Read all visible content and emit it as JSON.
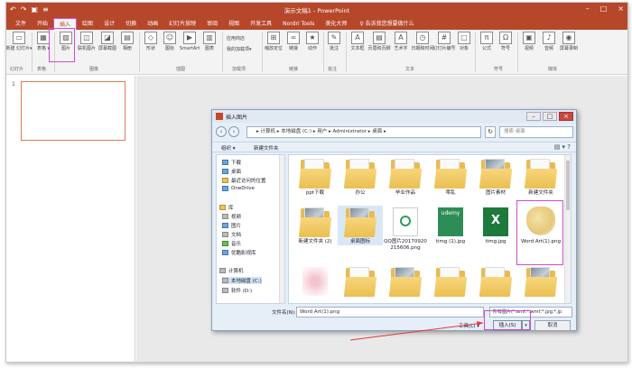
{
  "app": {
    "title": "演示文稿1 - PowerPoint",
    "qat": [
      "↶",
      "↷",
      "▣",
      "≡"
    ]
  },
  "ribbon_tabs": [
    "文件",
    "开始",
    "插入",
    "绘图",
    "设计",
    "切换",
    "动画",
    "幻灯片放映",
    "审阅",
    "视图",
    "开发工具",
    "Nordri Tools",
    "美化大师"
  ],
  "active_tab_index": 2,
  "tell_me": "♀ 告诉我您想要做什么",
  "ribbon": {
    "slides": {
      "label": "新建\n幻灯片▾",
      "group": "幻灯片"
    },
    "table": {
      "label": "表格\n▾",
      "group": "表格"
    },
    "images": {
      "buttons": [
        "图片",
        "联机图片",
        "屏幕截图",
        "相册"
      ],
      "group": "图像"
    },
    "illustrations": {
      "buttons": [
        "形状",
        "图标",
        "SmartArt",
        "图表"
      ],
      "group": "插图"
    },
    "addins": {
      "items": [
        "应用商店",
        "我的加载项▾"
      ],
      "group": "加载项"
    },
    "links": {
      "buttons": [
        "缩放定位",
        "链接",
        "动作"
      ],
      "group": "链接"
    },
    "comments": {
      "buttons": [
        "批注"
      ],
      "group": "批注"
    },
    "text": {
      "buttons": [
        "文本框",
        "页眉和页脚",
        "艺术字",
        "日期和时间",
        "幻灯片编号",
        "对象"
      ],
      "group": "文本"
    },
    "symbols": {
      "buttons": [
        "公式",
        "符号"
      ],
      "group": "符号"
    },
    "media": {
      "buttons": [
        "视频",
        "音频",
        "屏幕录制"
      ],
      "group": "媒体"
    }
  },
  "slide_pane": {
    "slide_number": "1"
  },
  "dialog": {
    "title": "插入图片",
    "address": "▸ 计算机 ▸ 本地磁盘 (C:) ▸ 用户 ▸ Administrator ▸ 桌面 ▸",
    "search_placeholder": "搜索 桌面",
    "toolbar": {
      "organize": "组织 ▾",
      "new_folder": "新建文件夹"
    },
    "nav_items": [
      {
        "label": "下载",
        "icon": "download-icon",
        "kind": "blue"
      },
      {
        "label": "桌面",
        "icon": "desktop-icon",
        "kind": "blue"
      },
      {
        "label": "最近访问的位置",
        "icon": "recent-icon",
        "kind": "yellow"
      },
      {
        "label": "OneDrive",
        "icon": "cloud-icon",
        "kind": "blue"
      },
      {
        "label": "库",
        "icon": "library-icon",
        "kind": "yellow"
      },
      {
        "label": "视频",
        "icon": "video-icon",
        "kind": "gray"
      },
      {
        "label": "图片",
        "icon": "picture-icon",
        "kind": "blue"
      },
      {
        "label": "文档",
        "icon": "document-icon",
        "kind": "gray"
      },
      {
        "label": "音乐",
        "icon": "music-icon",
        "kind": "green"
      },
      {
        "label": "优酷影视库",
        "icon": "video-library-icon",
        "kind": "blue"
      },
      {
        "label": "计算机",
        "icon": "computer-icon",
        "kind": "gray"
      },
      {
        "label": "本地磁盘 (C:)",
        "icon": "drive-icon",
        "kind": "gray"
      },
      {
        "label": "软件 (D:)",
        "icon": "drive-icon",
        "kind": "gray"
      }
    ],
    "files": [
      {
        "label": "ppt下载",
        "kind": "folder"
      },
      {
        "label": "办公",
        "kind": "folder"
      },
      {
        "label": "毕业作品",
        "kind": "folder"
      },
      {
        "label": "零乱",
        "kind": "folder"
      },
      {
        "label": "图片素材",
        "kind": "folder-pic"
      },
      {
        "label": "新建文件夹",
        "kind": "folder"
      },
      {
        "label": "新建文件夹 (2)",
        "kind": "folder-pic"
      },
      {
        "label": "桌面图标",
        "kind": "folder-pic"
      },
      {
        "label": "QQ图片20170920215606.png",
        "kind": "qq"
      },
      {
        "label": "timg (1).jpg",
        "kind": "udemy"
      },
      {
        "label": "timg.jpg",
        "kind": "xls"
      },
      {
        "label": "Word Art(1).png",
        "kind": "heart"
      },
      {
        "label": "",
        "kind": "pinkart"
      },
      {
        "label": "",
        "kind": "folder"
      },
      {
        "label": "",
        "kind": "folder-pic"
      },
      {
        "label": "",
        "kind": "folder"
      },
      {
        "label": "",
        "kind": "folder"
      },
      {
        "label": "",
        "kind": "folder-pic"
      }
    ],
    "filename_label": "文件名(N):",
    "filename_value": "Word Art(1).png",
    "filetype_value": "所有图片(*.emf;*.wmf;*.jpg;*.jp",
    "tools_label": "工具(L) ▾",
    "insert_label": "插入(S)",
    "insert_dropdown": "▾",
    "cancel_label": "取消",
    "udemy_text": "udemy",
    "xls_text": "X"
  },
  "colors": {
    "accent": "#b7472a",
    "highlight": "#d04bd0"
  }
}
